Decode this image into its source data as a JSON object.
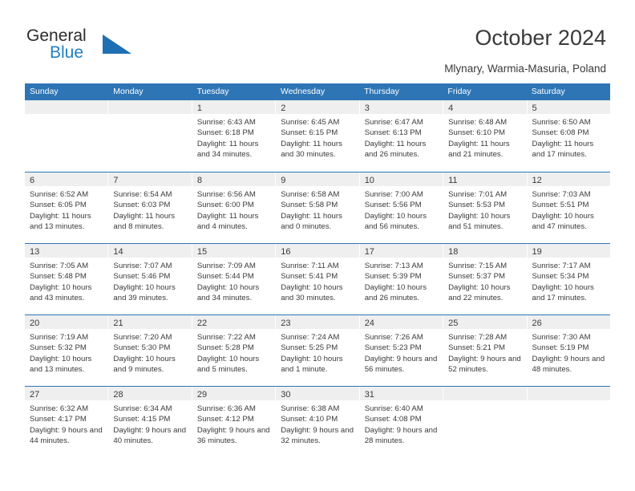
{
  "brand": {
    "name_part1": "General",
    "name_part2": "Blue",
    "logo_icon": "triangle-logo-icon",
    "colors": {
      "accent": "#1f7ec4",
      "header": "#2e75b6",
      "band": "#efefef"
    }
  },
  "header": {
    "title": "October 2024",
    "subtitle": "Mlynary, Warmia-Masuria, Poland"
  },
  "calendar": {
    "weekday_headers": [
      "Sunday",
      "Monday",
      "Tuesday",
      "Wednesday",
      "Thursday",
      "Friday",
      "Saturday"
    ],
    "weeks": [
      [
        {
          "day": "",
          "sunrise": "",
          "sunset": "",
          "daylight": "",
          "empty": true
        },
        {
          "day": "",
          "sunrise": "",
          "sunset": "",
          "daylight": "",
          "empty": true
        },
        {
          "day": "1",
          "sunrise": "Sunrise: 6:43 AM",
          "sunset": "Sunset: 6:18 PM",
          "daylight": "Daylight: 11 hours and 34 minutes."
        },
        {
          "day": "2",
          "sunrise": "Sunrise: 6:45 AM",
          "sunset": "Sunset: 6:15 PM",
          "daylight": "Daylight: 11 hours and 30 minutes."
        },
        {
          "day": "3",
          "sunrise": "Sunrise: 6:47 AM",
          "sunset": "Sunset: 6:13 PM",
          "daylight": "Daylight: 11 hours and 26 minutes."
        },
        {
          "day": "4",
          "sunrise": "Sunrise: 6:48 AM",
          "sunset": "Sunset: 6:10 PM",
          "daylight": "Daylight: 11 hours and 21 minutes."
        },
        {
          "day": "5",
          "sunrise": "Sunrise: 6:50 AM",
          "sunset": "Sunset: 6:08 PM",
          "daylight": "Daylight: 11 hours and 17 minutes."
        }
      ],
      [
        {
          "day": "6",
          "sunrise": "Sunrise: 6:52 AM",
          "sunset": "Sunset: 6:05 PM",
          "daylight": "Daylight: 11 hours and 13 minutes."
        },
        {
          "day": "7",
          "sunrise": "Sunrise: 6:54 AM",
          "sunset": "Sunset: 6:03 PM",
          "daylight": "Daylight: 11 hours and 8 minutes."
        },
        {
          "day": "8",
          "sunrise": "Sunrise: 6:56 AM",
          "sunset": "Sunset: 6:00 PM",
          "daylight": "Daylight: 11 hours and 4 minutes."
        },
        {
          "day": "9",
          "sunrise": "Sunrise: 6:58 AM",
          "sunset": "Sunset: 5:58 PM",
          "daylight": "Daylight: 11 hours and 0 minutes."
        },
        {
          "day": "10",
          "sunrise": "Sunrise: 7:00 AM",
          "sunset": "Sunset: 5:56 PM",
          "daylight": "Daylight: 10 hours and 56 minutes."
        },
        {
          "day": "11",
          "sunrise": "Sunrise: 7:01 AM",
          "sunset": "Sunset: 5:53 PM",
          "daylight": "Daylight: 10 hours and 51 minutes."
        },
        {
          "day": "12",
          "sunrise": "Sunrise: 7:03 AM",
          "sunset": "Sunset: 5:51 PM",
          "daylight": "Daylight: 10 hours and 47 minutes."
        }
      ],
      [
        {
          "day": "13",
          "sunrise": "Sunrise: 7:05 AM",
          "sunset": "Sunset: 5:48 PM",
          "daylight": "Daylight: 10 hours and 43 minutes."
        },
        {
          "day": "14",
          "sunrise": "Sunrise: 7:07 AM",
          "sunset": "Sunset: 5:46 PM",
          "daylight": "Daylight: 10 hours and 39 minutes."
        },
        {
          "day": "15",
          "sunrise": "Sunrise: 7:09 AM",
          "sunset": "Sunset: 5:44 PM",
          "daylight": "Daylight: 10 hours and 34 minutes."
        },
        {
          "day": "16",
          "sunrise": "Sunrise: 7:11 AM",
          "sunset": "Sunset: 5:41 PM",
          "daylight": "Daylight: 10 hours and 30 minutes."
        },
        {
          "day": "17",
          "sunrise": "Sunrise: 7:13 AM",
          "sunset": "Sunset: 5:39 PM",
          "daylight": "Daylight: 10 hours and 26 minutes."
        },
        {
          "day": "18",
          "sunrise": "Sunrise: 7:15 AM",
          "sunset": "Sunset: 5:37 PM",
          "daylight": "Daylight: 10 hours and 22 minutes."
        },
        {
          "day": "19",
          "sunrise": "Sunrise: 7:17 AM",
          "sunset": "Sunset: 5:34 PM",
          "daylight": "Daylight: 10 hours and 17 minutes."
        }
      ],
      [
        {
          "day": "20",
          "sunrise": "Sunrise: 7:19 AM",
          "sunset": "Sunset: 5:32 PM",
          "daylight": "Daylight: 10 hours and 13 minutes."
        },
        {
          "day": "21",
          "sunrise": "Sunrise: 7:20 AM",
          "sunset": "Sunset: 5:30 PM",
          "daylight": "Daylight: 10 hours and 9 minutes."
        },
        {
          "day": "22",
          "sunrise": "Sunrise: 7:22 AM",
          "sunset": "Sunset: 5:28 PM",
          "daylight": "Daylight: 10 hours and 5 minutes."
        },
        {
          "day": "23",
          "sunrise": "Sunrise: 7:24 AM",
          "sunset": "Sunset: 5:25 PM",
          "daylight": "Daylight: 10 hours and 1 minute."
        },
        {
          "day": "24",
          "sunrise": "Sunrise: 7:26 AM",
          "sunset": "Sunset: 5:23 PM",
          "daylight": "Daylight: 9 hours and 56 minutes."
        },
        {
          "day": "25",
          "sunrise": "Sunrise: 7:28 AM",
          "sunset": "Sunset: 5:21 PM",
          "daylight": "Daylight: 9 hours and 52 minutes."
        },
        {
          "day": "26",
          "sunrise": "Sunrise: 7:30 AM",
          "sunset": "Sunset: 5:19 PM",
          "daylight": "Daylight: 9 hours and 48 minutes."
        }
      ],
      [
        {
          "day": "27",
          "sunrise": "Sunrise: 6:32 AM",
          "sunset": "Sunset: 4:17 PM",
          "daylight": "Daylight: 9 hours and 44 minutes."
        },
        {
          "day": "28",
          "sunrise": "Sunrise: 6:34 AM",
          "sunset": "Sunset: 4:15 PM",
          "daylight": "Daylight: 9 hours and 40 minutes."
        },
        {
          "day": "29",
          "sunrise": "Sunrise: 6:36 AM",
          "sunset": "Sunset: 4:12 PM",
          "daylight": "Daylight: 9 hours and 36 minutes."
        },
        {
          "day": "30",
          "sunrise": "Sunrise: 6:38 AM",
          "sunset": "Sunset: 4:10 PM",
          "daylight": "Daylight: 9 hours and 32 minutes."
        },
        {
          "day": "31",
          "sunrise": "Sunrise: 6:40 AM",
          "sunset": "Sunset: 4:08 PM",
          "daylight": "Daylight: 9 hours and 28 minutes."
        },
        {
          "day": "",
          "sunrise": "",
          "sunset": "",
          "daylight": "",
          "empty": true
        },
        {
          "day": "",
          "sunrise": "",
          "sunset": "",
          "daylight": "",
          "empty": true
        }
      ]
    ]
  }
}
